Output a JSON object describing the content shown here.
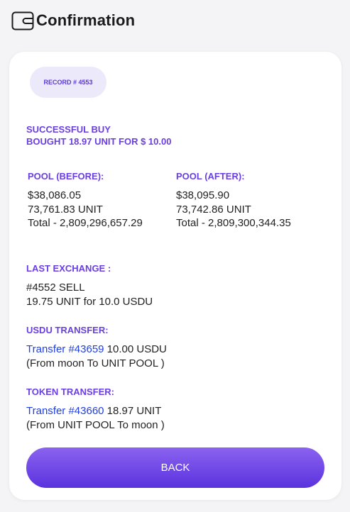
{
  "header": {
    "title": "Confirmation",
    "icon": "wallet-icon"
  },
  "record": {
    "label": "RECORD # 4553"
  },
  "status": {
    "line1": "SUCCESSFUL BUY",
    "line2": "BOUGHT 18.97 UNIT FOR $ 10.00"
  },
  "pool_before": {
    "heading": "POOL (BEFORE):",
    "usd": "$38,086.05",
    "units": "73,761.83 UNIT",
    "total": "Total - 2,809,296,657.29"
  },
  "pool_after": {
    "heading": "POOL (AFTER):",
    "usd": "$38,095.90",
    "units": "73,742.86 UNIT",
    "total": "Total - 2,809,300,344.35"
  },
  "last_exchange": {
    "heading": "LAST EXCHANGE :",
    "line1": "#4552 SELL",
    "line2": "19.75 UNIT for 10.0 USDU"
  },
  "usdu_transfer": {
    "heading": "USDU TRANSFER:",
    "link": "Transfer #43659",
    "amount": " 10.00 USDU",
    "route": "(From moon To UNIT POOL )"
  },
  "token_transfer": {
    "heading": "TOKEN TRANSFER:",
    "link": "Transfer #43660",
    "amount": " 18.97 UNIT",
    "route": "(From UNIT POOL To moon )"
  },
  "back_button": {
    "label": "BACK"
  },
  "colors": {
    "accent": "#6a3fe2",
    "link": "#1f3fe0",
    "button_top": "#8b63f0",
    "button_bottom": "#5a32de"
  }
}
